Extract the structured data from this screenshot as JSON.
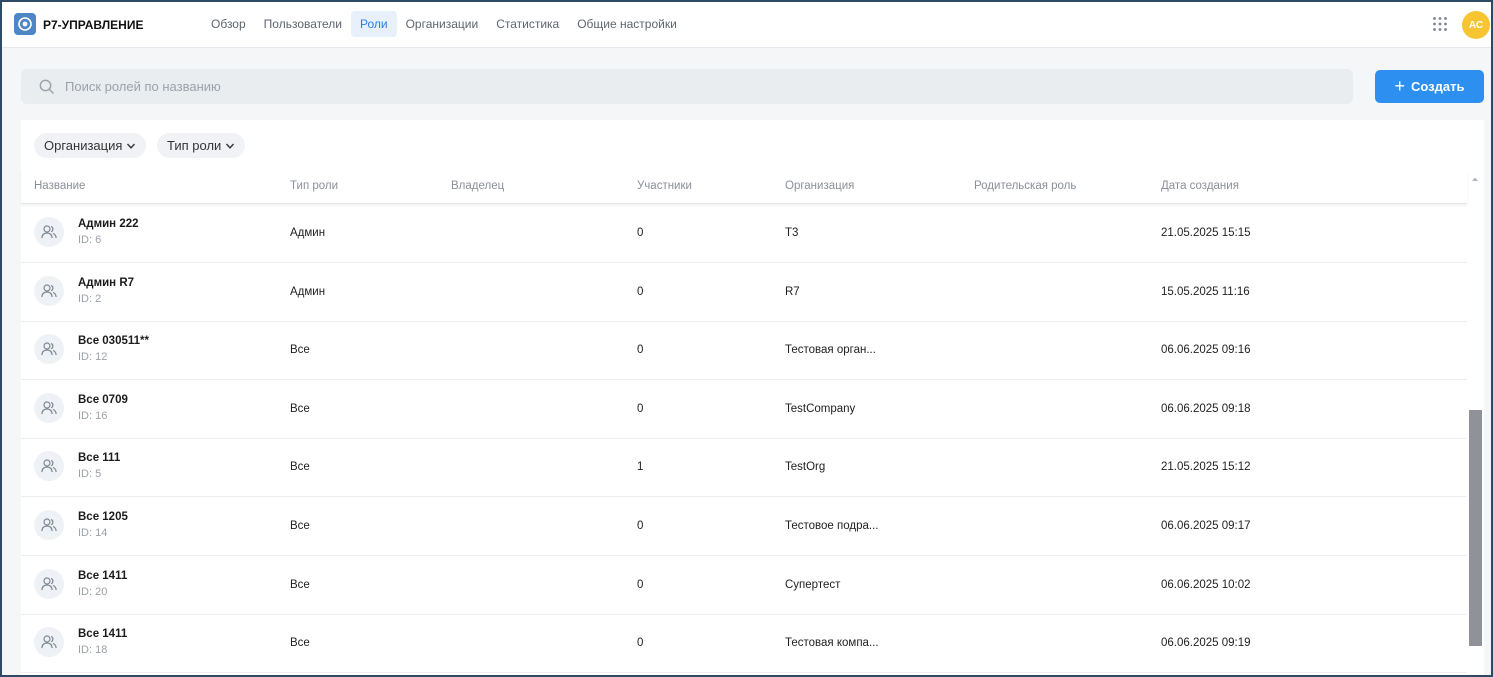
{
  "header": {
    "app_title": "Р7-УПРАВЛЕНИЕ",
    "nav": [
      {
        "label": "Обзор",
        "active": false
      },
      {
        "label": "Пользователи",
        "active": false
      },
      {
        "label": "Роли",
        "active": true
      },
      {
        "label": "Организации",
        "active": false
      },
      {
        "label": "Статистика",
        "active": false
      },
      {
        "label": "Общие настройки",
        "active": false
      }
    ],
    "avatar_initials": "АС",
    "icons": {
      "logo": "gear-logo-icon",
      "apps": "grid-dots-icon"
    }
  },
  "search": {
    "placeholder": "Поиск ролей по названию",
    "value": "",
    "icon": "search-icon"
  },
  "create_button": {
    "label": "Создать",
    "icon": "plus-icon"
  },
  "filters": [
    {
      "label": "Организация",
      "icon": "chevron-down-icon"
    },
    {
      "label": "Тип роли",
      "icon": "chevron-down-icon"
    }
  ],
  "table": {
    "columns": [
      "Название",
      "Тип роли",
      "Владелец",
      "Участники",
      "Организация",
      "Родительская роль",
      "Дата создания"
    ],
    "rows": [
      {
        "name": "Админ 222",
        "id": "ID: 6",
        "type": "Админ",
        "owner": "",
        "members": "0",
        "org": "Т3",
        "parent": "",
        "created": "21.05.2025 15:15"
      },
      {
        "name": "Админ R7",
        "id": "ID: 2",
        "type": "Админ",
        "owner": "",
        "members": "0",
        "org": "R7",
        "parent": "",
        "created": "15.05.2025 11:16"
      },
      {
        "name": "Все 030511**",
        "id": "ID: 12",
        "type": "Все",
        "owner": "",
        "members": "0",
        "org": "Тестовая орган...",
        "parent": "",
        "created": "06.06.2025 09:16"
      },
      {
        "name": "Все 0709",
        "id": "ID: 16",
        "type": "Все",
        "owner": "",
        "members": "0",
        "org": "TestCompany",
        "parent": "",
        "created": "06.06.2025 09:18"
      },
      {
        "name": "Все 111",
        "id": "ID: 5",
        "type": "Все",
        "owner": "",
        "members": "1",
        "org": "TestOrg",
        "parent": "",
        "created": "21.05.2025 15:12"
      },
      {
        "name": "Все 1205",
        "id": "ID: 14",
        "type": "Все",
        "owner": "",
        "members": "0",
        "org": "Тестовое подра...",
        "parent": "",
        "created": "06.06.2025 09:17"
      },
      {
        "name": "Все 1411",
        "id": "ID: 20",
        "type": "Все",
        "owner": "",
        "members": "0",
        "org": "Супертест",
        "parent": "",
        "created": "06.06.2025 10:02"
      },
      {
        "name": "Все 1411",
        "id": "ID: 18",
        "type": "Все",
        "owner": "",
        "members": "0",
        "org": "Тестовая компа...",
        "parent": "",
        "created": "06.06.2025 09:19"
      }
    ]
  },
  "colors": {
    "accent": "#2d8ff0",
    "active_tab_bg": "#e7f0fb",
    "avatar_bg": "#f6c531",
    "logo_bg": "#4f86c6"
  }
}
